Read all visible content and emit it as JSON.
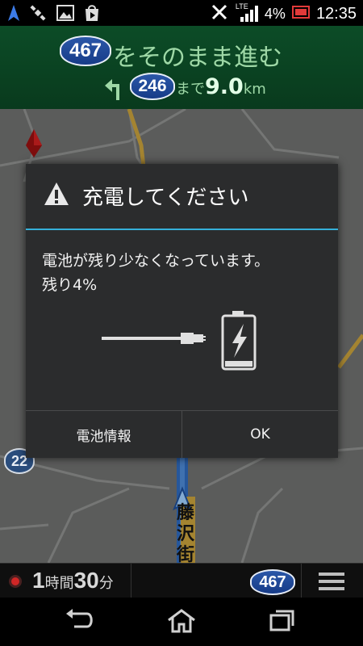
{
  "status_bar": {
    "network_label": "LTE",
    "battery_percent": "4%",
    "time": "12:35",
    "icons": [
      "navigation-arrow-icon",
      "satellite-icon",
      "image-icon",
      "play-store-icon",
      "vibrate-icon",
      "signal-icon",
      "battery-low-icon"
    ]
  },
  "nav_banner": {
    "route_number": "467",
    "instruction": "をそのまま進む",
    "next_route_number": "246",
    "distance_prefix": "まで",
    "distance_value": "9.0",
    "distance_unit": "km",
    "turn_direction": "turn-left-icon"
  },
  "map": {
    "route_badge": "22",
    "road_label": "藤沢街道",
    "road_color": "#c9a23c",
    "background_color": "#6f7170"
  },
  "dialog": {
    "title": "充電してください",
    "message_line1": "電池が残り少なくなっています。",
    "message_line2": "残り4%",
    "battery_info_button": "電池情報",
    "ok_button": "OK",
    "accent_color": "#35b0d9"
  },
  "info_bar": {
    "eta_hours": "1",
    "eta_hours_unit": "時間",
    "eta_minutes": "30",
    "eta_minutes_unit": "分",
    "route_number": "467"
  }
}
